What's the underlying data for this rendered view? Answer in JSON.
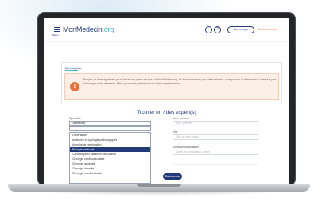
{
  "header": {
    "menu_label": "Menu",
    "logo_main": "MonMedecin",
    "logo_accent": ".org",
    "icons": [
      "car-icon",
      "question-icon",
      "info-icon"
    ],
    "account_label": "Mon compte",
    "link_label": "Se déconnecter"
  },
  "notice": {
    "title": "Messagerie",
    "text": "Bonjour, la Messagerie est pour l'instant en phase de test sur MonMedecin.org. Si vous ne trouvez pas votre médecin, vous pouvez le rechercher ci-dessous puis lui envoyer votre demande. Merci pour votre patience et de votre compréhension."
  },
  "search": {
    "title": "Trouver un / des expert(s)",
    "specialty_label": "Spécialité",
    "specialty_value": "Généraliste",
    "options": [
      "Généraliste",
      "Anatomie et cytologie pathologiques",
      "Anesthésie réanimation",
      "Biologie médicale",
      "Cardiologie et maladies vasculaires",
      "Chirurgie cardiovasculaire",
      "Chirurgie générale",
      "Chirurgie infantile",
      "Chirurgie maxillo-faciale"
    ],
    "selected_index": 3,
    "field_labels": [
      "Nom, prénom",
      "Ville",
      "Accès de consultation"
    ],
    "field_placeholders": [
      "Nom, prénom",
      "Ville ou code postal",
      "Accès de consultation, virtuel"
    ],
    "submit_label": "Rechercher"
  },
  "colors": {
    "brand_navy": "#233a79",
    "brand_cyan": "#3fb3d6",
    "alert_orange": "#e8703a"
  }
}
